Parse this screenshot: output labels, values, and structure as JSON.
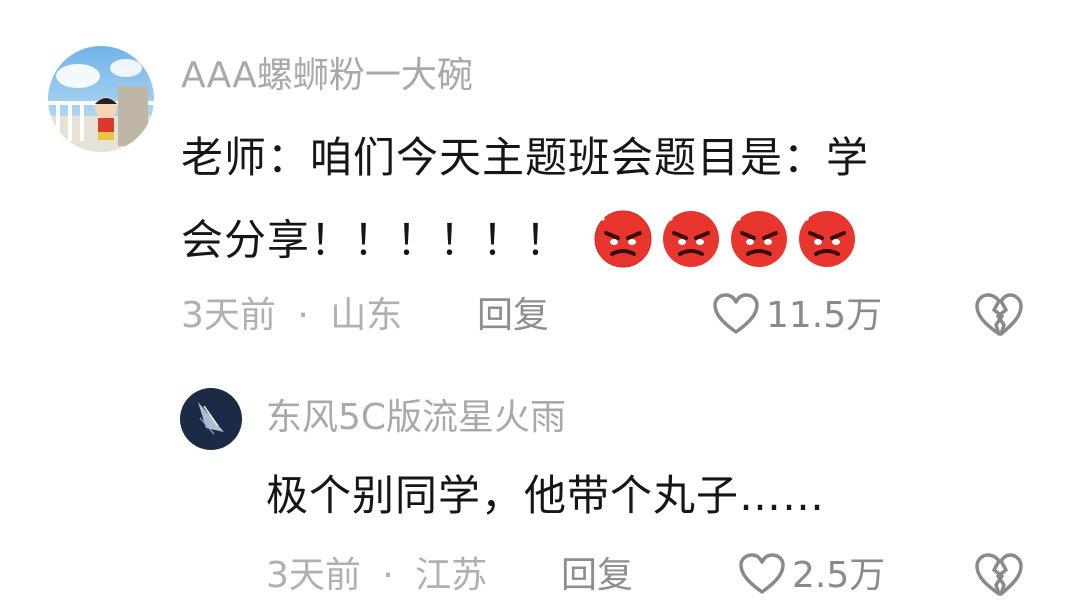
{
  "comments": [
    {
      "username": "AAA螺蛳粉一大碗",
      "content_line1": "老师：咱们今天主题班会题目是：学",
      "content_line2": "会分享！！！！！！",
      "emoji": "angry-face-emoji",
      "emoji_count": 4,
      "time": "3天前",
      "separator": "·",
      "location": "山东",
      "reply_label": "回复",
      "likes": "11.5万"
    },
    {
      "username": "东风5C版流星火雨",
      "content": "极个别同学，他带个丸子……",
      "time": "3天前",
      "separator": "·",
      "location": "江苏",
      "reply_label": "回复",
      "likes": "2.5万"
    }
  ],
  "colors": {
    "username": "#a9a9a9",
    "text": "#161616",
    "meta": "#b0b0b0",
    "emoji_red": "#e8362f"
  }
}
